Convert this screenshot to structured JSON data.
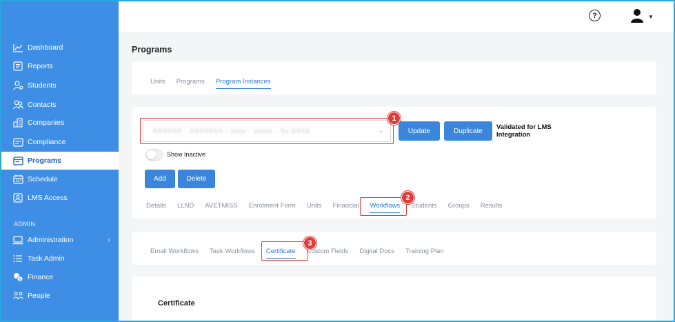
{
  "sidebar": {
    "items": [
      {
        "label": "Dashboard",
        "icon": "chart-line-icon"
      },
      {
        "label": "Reports",
        "icon": "report-icon"
      },
      {
        "label": "Students",
        "icon": "students-icon"
      },
      {
        "label": "Contacts",
        "icon": "contacts-icon"
      },
      {
        "label": "Companies",
        "icon": "companies-icon"
      },
      {
        "label": "Compliance",
        "icon": "compliance-icon"
      },
      {
        "label": "Programs",
        "icon": "programs-icon",
        "active": true
      },
      {
        "label": "Schedule",
        "icon": "schedule-icon"
      },
      {
        "label": "LMS Access",
        "icon": "lms-icon"
      }
    ],
    "admin_section_label": "ADMIN",
    "admin_items": [
      {
        "label": "Administration",
        "icon": "laptop-icon"
      },
      {
        "label": "Task Admin",
        "icon": "list-icon"
      },
      {
        "label": "Finance",
        "icon": "coins-icon"
      },
      {
        "label": "People",
        "icon": "people-icon"
      }
    ]
  },
  "header": {
    "help_glyph": "?"
  },
  "page": {
    "title": "Programs"
  },
  "top_tabs": [
    {
      "label": "Units"
    },
    {
      "label": "Programs"
    },
    {
      "label": "Program Instances",
      "active": true
    }
  ],
  "instance": {
    "select_value": "XXXXXX - XXXXXXX - xxxx - xxxxx - Xx XXXX",
    "update_label": "Update",
    "duplicate_label": "Duplicate",
    "lms_label": "Validated for LMS Integration",
    "show_inactive_label": "Show Inactive",
    "add_label": "Add",
    "delete_label": "Delete"
  },
  "detail_tabs": [
    {
      "label": "Details"
    },
    {
      "label": "LLND"
    },
    {
      "label": "AVETMISS"
    },
    {
      "label": "Enrolment Form"
    },
    {
      "label": "Units"
    },
    {
      "label": "Financial"
    },
    {
      "label": "Workflows",
      "active": true
    },
    {
      "label": "Students"
    },
    {
      "label": "Groups"
    },
    {
      "label": "Results"
    }
  ],
  "workflow_tabs": [
    {
      "label": "Email Workflows"
    },
    {
      "label": "Task Workflows"
    },
    {
      "label": "Certificate",
      "active": true
    },
    {
      "label": "Custom Fields"
    },
    {
      "label": "Digital Docs"
    },
    {
      "label": "Training Plan"
    }
  ],
  "certificate": {
    "title": "Certificate"
  },
  "annotations": [
    "1",
    "2",
    "3"
  ],
  "colors": {
    "sidebar_bg": "#3f8ee6",
    "accent": "#2b7bd6",
    "button": "#3a86dd",
    "callout_red": "#e23b3b"
  }
}
